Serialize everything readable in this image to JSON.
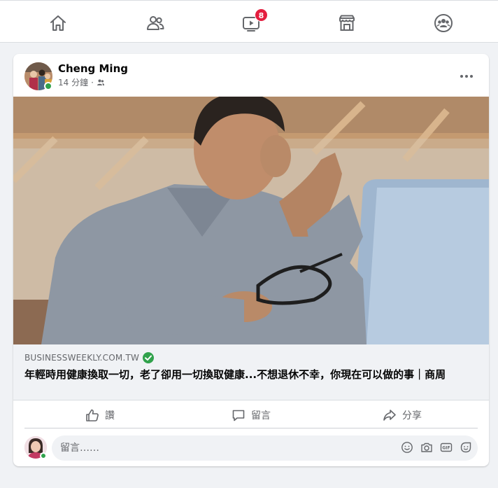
{
  "nav": {
    "items": [
      {
        "icon": "home-icon"
      },
      {
        "icon": "friends-icon"
      },
      {
        "icon": "watch-icon",
        "badge": "8"
      },
      {
        "icon": "marketplace-icon"
      },
      {
        "icon": "groups-icon"
      }
    ]
  },
  "post": {
    "author": "Cheng Ming",
    "time": "14 分鐘",
    "separator": "·",
    "audience_icon": "friends-audience-icon",
    "link": {
      "domain": "BUSINESSWEEKLY.COM.TW",
      "title": "年輕時用健康換取一切，老了卻用一切換取健康...不想退休不幸，你現在可以做的事｜商周"
    },
    "actions": {
      "like": "讚",
      "comment": "留言",
      "share": "分享"
    },
    "comment_placeholder": "留言……"
  },
  "colors": {
    "badge": "#e41e3f",
    "online": "#31a24c",
    "secondary_text": "#65676b",
    "page_bg": "#f0f2f5"
  }
}
